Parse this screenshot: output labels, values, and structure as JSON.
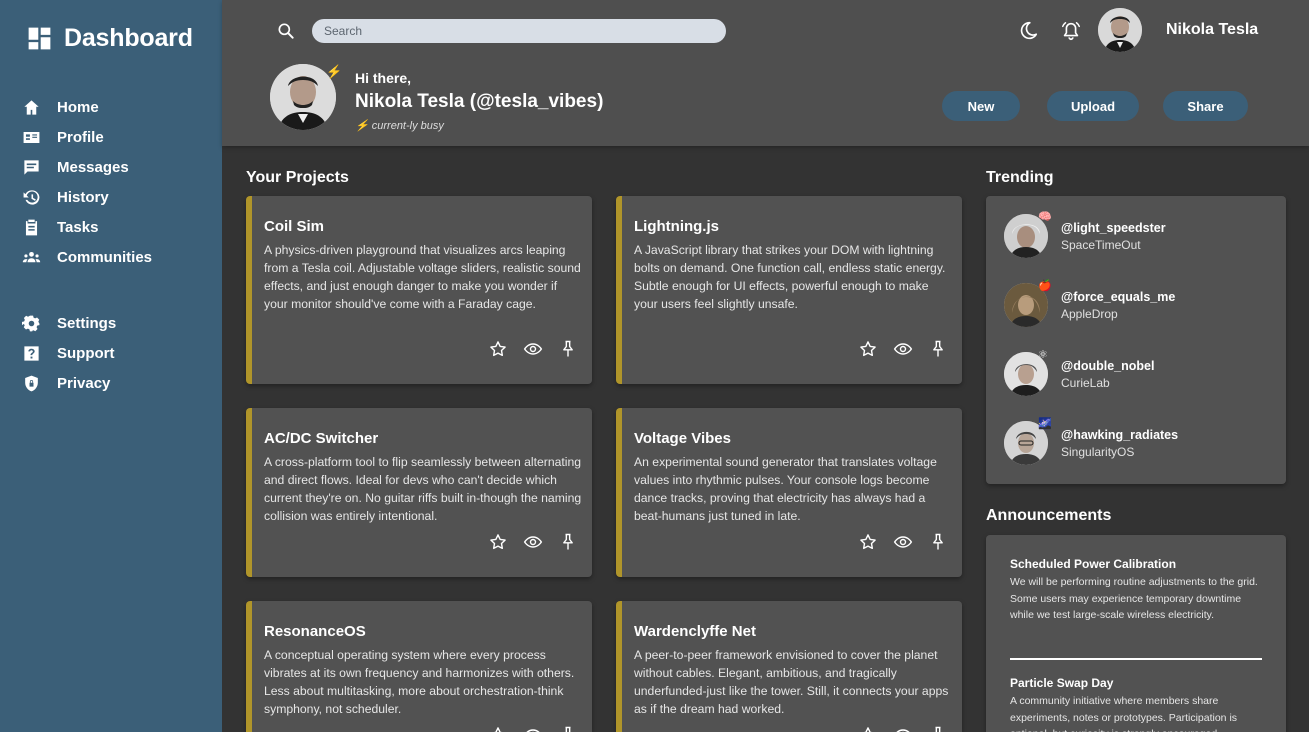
{
  "sidebar": {
    "brand": "Dashboard",
    "items": [
      {
        "label": "Home",
        "icon": "home-icon"
      },
      {
        "label": "Profile",
        "icon": "id-card-icon"
      },
      {
        "label": "Messages",
        "icon": "message-icon"
      },
      {
        "label": "History",
        "icon": "history-icon"
      },
      {
        "label": "Tasks",
        "icon": "clipboard-icon"
      },
      {
        "label": "Communities",
        "icon": "group-icon"
      }
    ],
    "secondary": [
      {
        "label": "Settings",
        "icon": "gear-icon"
      },
      {
        "label": "Support",
        "icon": "question-icon"
      },
      {
        "label": "Privacy",
        "icon": "shield-icon"
      }
    ]
  },
  "header": {
    "search_placeholder": "Search",
    "user_name": "Nikola Tesla",
    "greeting": "Hi there,",
    "handle": "Nikola Tesla (@tesla_vibes)",
    "status": "⚡ current-ly busy",
    "avatar_badge": "⚡",
    "buttons": {
      "new": "New",
      "upload": "Upload",
      "share": "Share"
    }
  },
  "projects": {
    "title": "Your Projects",
    "items": [
      {
        "name": "Coil Sim",
        "description": "A physics-driven playground that visualizes arcs leaping from a Tesla coil. Adjustable voltage sliders, realistic sound effects, and just enough danger to make you wonder if your monitor should've come with a Faraday cage."
      },
      {
        "name": "Lightning.js",
        "description": "A JavaScript library that strikes your DOM with lightning bolts on demand. One function call, endless static energy. Subtle enough for UI effects, powerful enough to make your users feel slightly unsafe."
      },
      {
        "name": "AC/DC Switcher",
        "description": "A cross-platform tool to flip seamlessly between alternating and direct flows. Ideal for devs who can't decide which current they're on. No guitar riffs built in-though the naming collision was entirely intentional."
      },
      {
        "name": "Voltage Vibes",
        "description": "An experimental sound generator that translates voltage values into rhythmic pulses. Your console logs become dance tracks, proving that electricity has always had a beat-humans just tuned in late."
      },
      {
        "name": "ResonanceOS",
        "description": "A conceptual operating system where every process vibrates at its own frequency and harmonizes with others. Less about multitasking, more about orchestration-think symphony, not scheduler."
      },
      {
        "name": "Wardenclyffe Net",
        "description": "A peer-to-peer framework envisioned to cover the planet without cables. Elegant, ambitious, and tragically underfunded-just like the tower. Still, it connects your apps as if the dream had worked."
      }
    ]
  },
  "trending": {
    "title": "Trending",
    "items": [
      {
        "handle": "@light_speedster",
        "sub": "SpaceTimeOut",
        "badge": "🧠",
        "hair": "#e8e8e8"
      },
      {
        "handle": "@force_equals_me",
        "sub": "AppleDrop",
        "badge": "🍎",
        "hair": "#8a6a3a"
      },
      {
        "handle": "@double_nobel",
        "sub": "CurieLab",
        "badge": "⚛",
        "hair": "#9a9a9a"
      },
      {
        "handle": "@hawking_radiates",
        "sub": "SingularityOS",
        "badge": "🌌",
        "hair": "#6a6a6a"
      }
    ]
  },
  "announcements": {
    "title": "Announcements",
    "items": [
      {
        "title": "Scheduled Power Calibration",
        "body": "We will be performing routine adjustments to the grid. Some users may experience temporary downtime while we test large-scale wireless electricity."
      },
      {
        "title": "Particle Swap Day",
        "body": "A community initiative where members share experiments, notes or prototypes. Participation is optional, but curiosity is strongly encouraged."
      }
    ]
  },
  "colors": {
    "sidebar": "#3b5f78",
    "accent": "#b0952a",
    "card": "#525252",
    "header": "#4f4f4f",
    "background": "#333333"
  }
}
